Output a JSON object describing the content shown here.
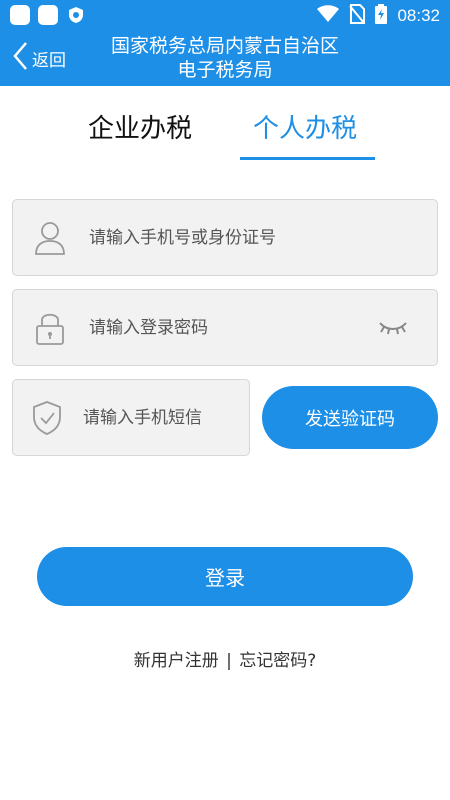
{
  "status_bar": {
    "time": "08:32"
  },
  "header": {
    "back_label": "返回",
    "title_line1": "国家税务总局内蒙古自治区",
    "title_line2": "电子税务局"
  },
  "tabs": [
    {
      "label": "企业办税",
      "active": false
    },
    {
      "label": "个人办税",
      "active": true
    }
  ],
  "form": {
    "phone_placeholder": "请输入手机号或身份证号",
    "password_placeholder": "请输入登录密码",
    "sms_placeholder": "请输入手机短信",
    "send_code_label": "发送验证码",
    "login_label": "登录"
  },
  "links": {
    "register": "新用户注册",
    "separator": "|",
    "forgot": "忘记密码?"
  },
  "colors": {
    "primary": "#1e8fe6",
    "field_bg": "#f2f2f2",
    "icon_gray": "#9a9a9a"
  },
  "icons": [
    "app-icon",
    "app-icon",
    "shield-icon",
    "wifi-icon",
    "no-sim-icon",
    "battery-icon",
    "back-chevron-icon",
    "user-icon",
    "lock-icon",
    "shield-check-icon",
    "eye-closed-icon"
  ]
}
